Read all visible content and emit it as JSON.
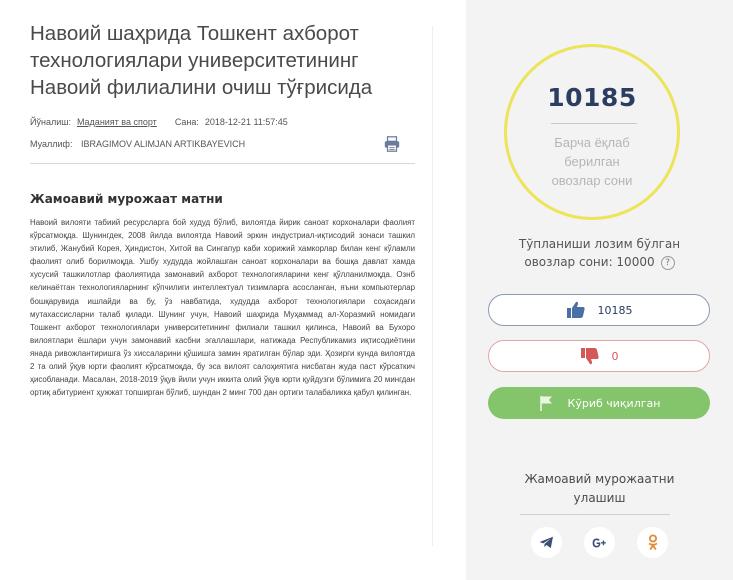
{
  "article": {
    "title_lines": [
      "Навоий шаҳрида Тошкент ахборот",
      "технологиялари университетининг",
      "Навоий филиалини очиш тўғрисида"
    ],
    "direction_label": "Йўналиш:",
    "direction_value": "Маданият ва спорт",
    "date_label": "Сана:",
    "date_value": "2018-12-21 11:57:45",
    "author_label": "Муаллиф:",
    "author_value": "IBRAGIMOV ALIMJAN ARTIKBAYEVICH",
    "section_heading": "Жамоавий мурожаат матни",
    "body": "Навоий вилояти табиий ресурсларга бой худуд бўлиб, вилоятда йирик саноат корхоналари фаолият кўрсатмоқда. Шунингдек, 2008 йилда вилоятда Навоий эркин индустриал-иқтисодий зонаси ташкил этилиб, Жанубий Корея, Ҳиндистон, Хитой ва Сингапур каби хорижий хамкорлар билан кенг кўламли фаолият олиб борилмоқда. Ушбу худудда жойлашган саноат корхоналари ва бошқа давлат хамда хусусий ташкилотлар фаолиятида замонавий ахборот технологияларини кенг қўлланилмоқда. Ознб келинаётган технологияларнинг кўпчилиги интеллектуал тизимларга асосланган, яъни компьютерлар бошқарувида ишлайди ва бу, ўз навбатида, худудда ахборот технологиялари соҳасидаги мутахассисларни талаб қилади. Шунинг учун, Навоий шаҳрида Муҳаммад ал-Хоразмий номидаги Тошкент ахборот технологиялари университетининг филиали ташкил қилинса, Навоий ва Бухоро вилоятлари ёшлари учун замонавий касбни эгаллашлари, натижада Республикамиз иқтисодиётини янада ривожлантиришга ўз хиссаларини қўшишга замин яратилган бўлар эди. Ҳозирги кунда вилоятда 2 та олий ўқув юрти фаолият кўрсатмоқда, бу эса вилоят салоҳиятига нисбатан жуда паст кўрсаткич ҳисобланади. Масалан, 2018-2019 ўқув йили учун иккита олий ўқув юрти қуйдузги бўлимига 20 мингдан ортиқ абитуриент ҳужжат топширган бўлиб, шундан 2 минг 700 дан ортиги талабаликка қабул қилинган."
  },
  "votes": {
    "total": "10185",
    "total_caption_lines": [
      "Барча ёқлаб",
      "берилган",
      "овозлар сони"
    ],
    "needed_text_line1": "Тўпланиши лозим бўлган",
    "needed_text_line2": "овозлар сони: 10000",
    "help_symbol": "?",
    "likes": "10185",
    "dislikes": "0",
    "status_button": "Кўриб чиқилган"
  },
  "share": {
    "heading_line1": "Жамоавий мурожаатни",
    "heading_line2": "улашиш"
  },
  "icons": [
    "printer-icon",
    "thumbs-up-icon",
    "thumbs-down-icon",
    "flag-icon",
    "telegram-icon",
    "google-icon",
    "odnoklassniki-icon"
  ],
  "colors": {
    "accent_navy": "#2b3d62",
    "circle_yellow": "#ece45a",
    "green": "#84c46b",
    "red": "#d55757"
  }
}
